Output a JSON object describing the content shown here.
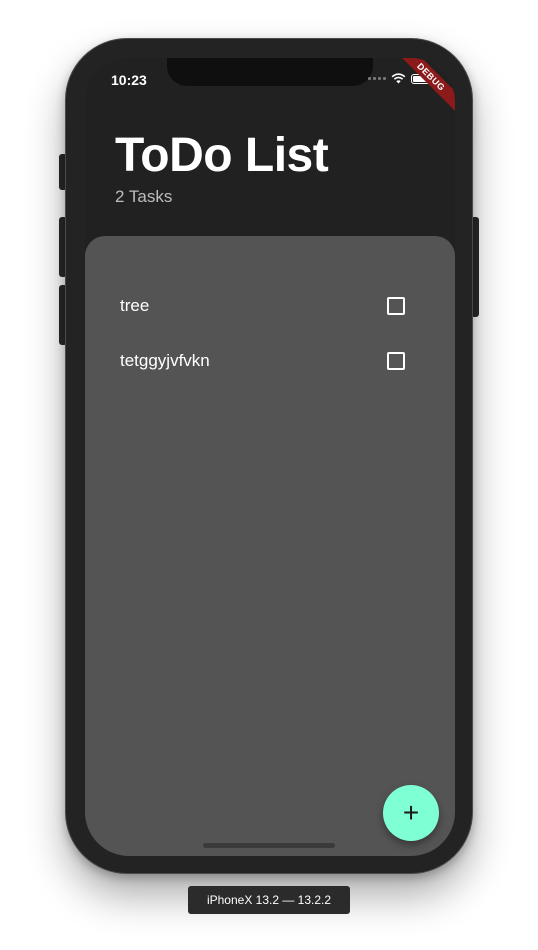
{
  "status_bar": {
    "time": "10:23",
    "debug_label": "DEBUG"
  },
  "header": {
    "title": "ToDo List",
    "task_count": "2 Tasks"
  },
  "tasks": [
    {
      "label": "tree",
      "checked": false
    },
    {
      "label": "tetggyjvfvkn",
      "checked": false
    }
  ],
  "fab": {
    "icon": "plus-icon",
    "glyph": "+",
    "color": "#7fffd4"
  },
  "device_label": "iPhoneX 13.2 — 13.2.2",
  "colors": {
    "background": "#212121",
    "panel": "#545454",
    "accent": "#7fffd4"
  }
}
